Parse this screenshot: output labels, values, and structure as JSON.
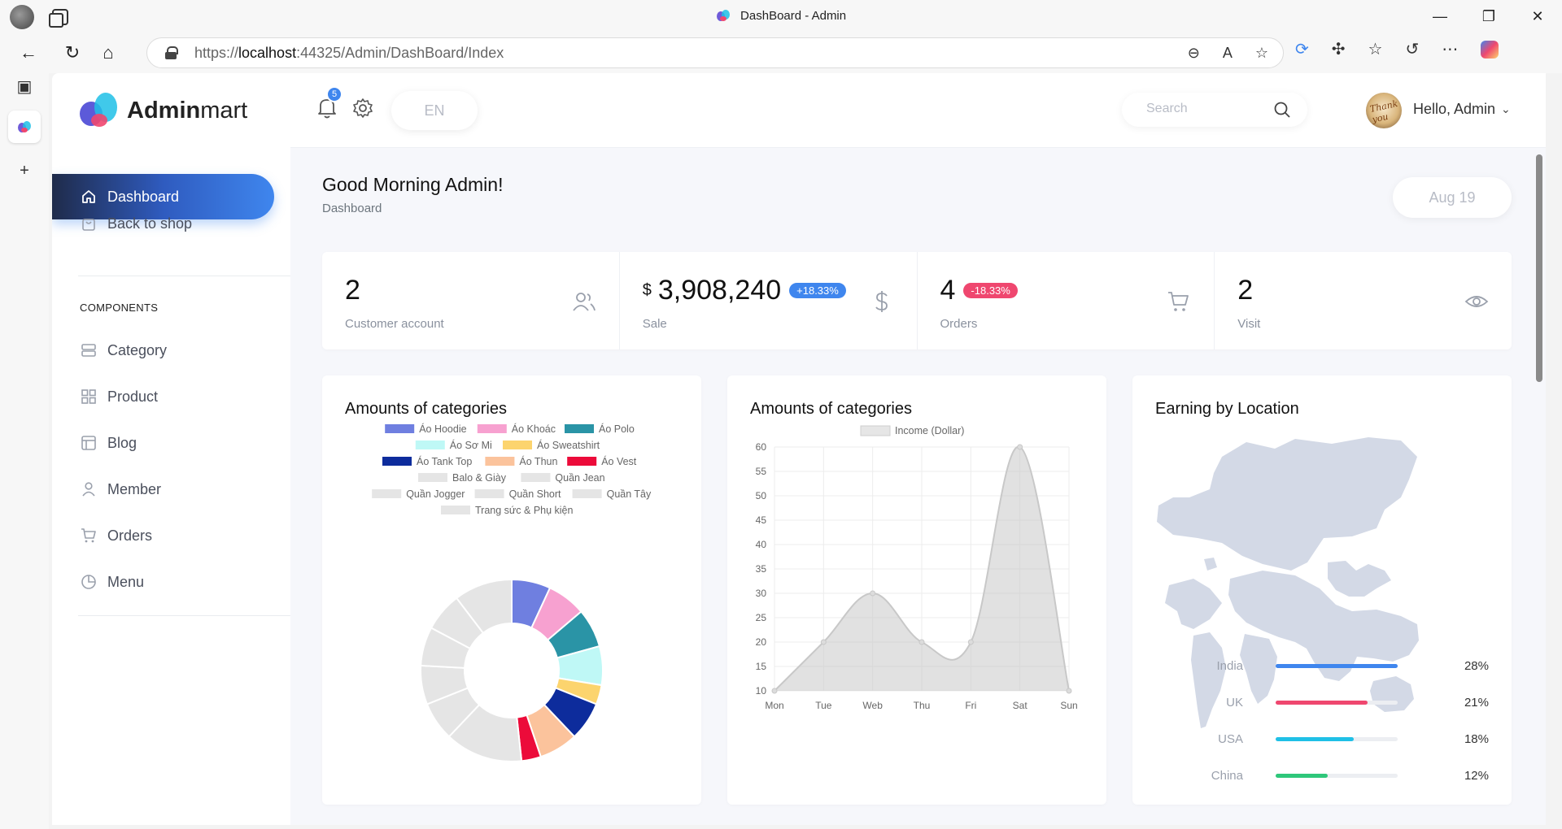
{
  "browser": {
    "window_title": "DashBoard - Admin",
    "url_prefix": "https://",
    "url_host": "localhost",
    "url_rest": ":44325/Admin/DashBoard/Index",
    "controls": {
      "minimize": "—",
      "maximize": "❐",
      "close": "✕"
    }
  },
  "brand": {
    "bold": "Admin",
    "light": "mart"
  },
  "sidebar": {
    "active": {
      "label": "Dashboard",
      "icon": "home-icon"
    },
    "back_to_shop": {
      "label": "Back to shop",
      "icon": "shopping-bag-icon"
    },
    "section_heading": "COMPONENTS",
    "items": [
      {
        "label": "Category",
        "icon": "server-icon"
      },
      {
        "label": "Product",
        "icon": "grid-icon"
      },
      {
        "label": "Blog",
        "icon": "layout-icon"
      },
      {
        "label": "Member",
        "icon": "user-icon"
      },
      {
        "label": "Orders",
        "icon": "cart-icon"
      },
      {
        "label": "Menu",
        "icon": "pie-icon"
      }
    ]
  },
  "topbar": {
    "notification_count": "5",
    "language": "EN",
    "search_placeholder": "Search",
    "greeting_user": "Hello, Admin",
    "avatar_text": "Thank you"
  },
  "page": {
    "greeting": "Good Morning Admin!",
    "breadcrumb": "Dashboard",
    "date": "Aug 19"
  },
  "stats": [
    {
      "value": "2",
      "currency": "",
      "change": "",
      "label": "Customer account",
      "icon": "users-icon"
    },
    {
      "value": "3,908,240",
      "currency": "$",
      "change": "+18.33%",
      "change_dir": "up",
      "label": "Sale",
      "icon": "dollar-icon"
    },
    {
      "value": "4",
      "currency": "",
      "change": "-18.33%",
      "change_dir": "down",
      "label": "Orders",
      "icon": "cart-icon"
    },
    {
      "value": "2",
      "currency": "",
      "change": "",
      "label": "Visit",
      "icon": "eye-icon"
    }
  ],
  "cards": {
    "doughnut_title": "Amounts of categories",
    "line_title": "Amounts of categories",
    "map_title": "Earning by Location"
  },
  "chart_data": [
    {
      "type": "doughnut",
      "title": "Amounts of categories",
      "categories": [
        "Áo Hoodie",
        "Áo Khoác",
        "Áo Polo",
        "Áo Sơ Mi",
        "Áo Sweatshirt",
        "Áo Tank Top",
        "Áo Thun",
        "Áo Vest",
        "Balo & Giày",
        "Quần Jean",
        "Quần Jogger",
        "Quần Short",
        "Quần Tây",
        "Trang sức & Phụ kiện"
      ],
      "values": [
        1,
        1,
        1,
        1,
        0.5,
        1,
        1,
        0.5,
        2,
        1,
        1,
        1,
        1,
        1.5
      ],
      "colors": [
        "#6f7fe0",
        "#f7a1d0",
        "#2a94a6",
        "#bff8f6",
        "#fcd46e",
        "#0d2c9c",
        "#fbc39c",
        "#ec0b3a",
        "#e5e5e5",
        "#e5e5e5",
        "#e5e5e5",
        "#e5e5e5",
        "#e5e5e5",
        "#e5e5e5"
      ]
    },
    {
      "type": "area",
      "title": "Amounts of categories",
      "series": [
        {
          "name": "Income (Dollar)",
          "values": [
            10,
            20,
            30,
            20,
            20,
            60,
            10
          ]
        }
      ],
      "categories": [
        "Mon",
        "Tue",
        "Web",
        "Thu",
        "Fri",
        "Sat",
        "Sun"
      ],
      "ylim": [
        10,
        60
      ],
      "yticks": [
        10,
        15,
        20,
        25,
        30,
        35,
        40,
        45,
        50,
        55,
        60
      ],
      "grid": true,
      "legend": "top"
    },
    {
      "type": "bar",
      "title": "Earning by Location",
      "categories": [
        "India",
        "UK",
        "USA",
        "China"
      ],
      "values": [
        28,
        21,
        18,
        12
      ],
      "labels": [
        "28%",
        "21%",
        "18%",
        "12%"
      ],
      "colors": [
        "#3f86ee",
        "#ef476f",
        "#1fc0e6",
        "#2ec77a"
      ]
    }
  ]
}
